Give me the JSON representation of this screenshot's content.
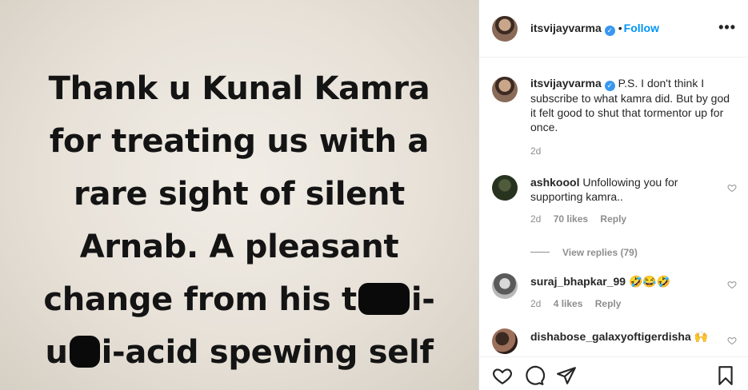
{
  "post": {
    "lines": [
      "Thank u Kunal Kamra",
      "for treating us with a",
      "rare sight of silent",
      "Arnab.  A pleasant"
    ],
    "line5_start": "change from his t",
    "line5_end": "i-",
    "line6_start": "u",
    "line6_end": "i-acid spewing self"
  },
  "header": {
    "username": "itsvijayvarma",
    "dot": "•",
    "follow_label": "Follow",
    "more_label": "•••"
  },
  "caption": {
    "username": "itsvijayvarma",
    "text": "P.S. I don't think I subscribe to what kamra did. But by god it felt good to shut that tormentor up for once.",
    "time": "2d"
  },
  "comments": [
    {
      "username": "ashkoool",
      "text": "Unfollowing you for supporting kamra..",
      "time": "2d",
      "likes": "70 likes",
      "reply": "Reply",
      "view_replies": "View replies (79)"
    },
    {
      "username": "suraj_bhapkar_99",
      "text": "🤣😂🤣",
      "time": "2d",
      "likes": "4 likes",
      "reply": "Reply"
    },
    {
      "username": "dishabose_galaxyoftigerdisha",
      "text": "🙌"
    }
  ],
  "icons": {
    "verified": "✓",
    "like": "heart-icon",
    "comment": "comment-icon",
    "share": "share-icon",
    "save": "bookmark-icon"
  }
}
